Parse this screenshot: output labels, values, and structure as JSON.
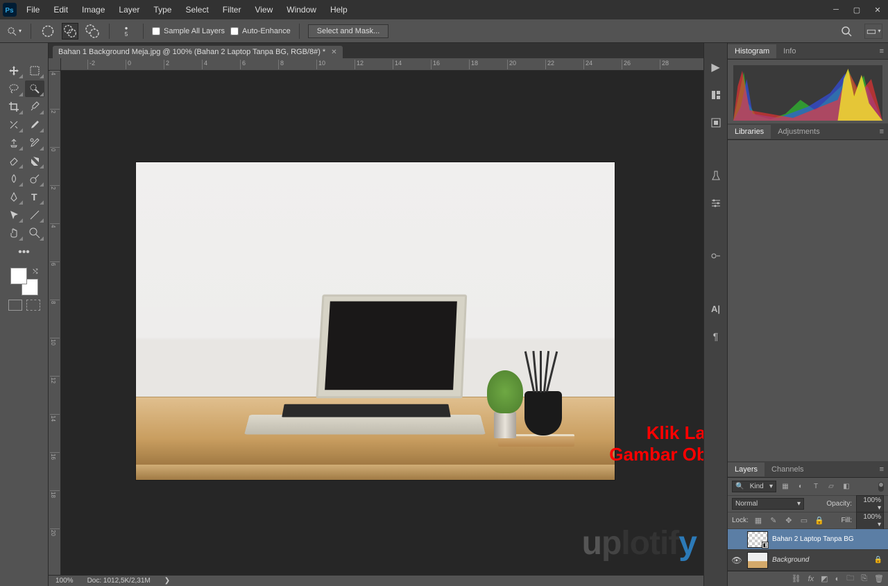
{
  "menubar": [
    "File",
    "Edit",
    "Image",
    "Layer",
    "Type",
    "Select",
    "Filter",
    "View",
    "Window",
    "Help"
  ],
  "options": {
    "brush_size": "5",
    "sample_all": "Sample All Layers",
    "auto_enhance": "Auto-Enhance",
    "select_mask": "Select and Mask..."
  },
  "doc_tab": "Bahan 1 Background Meja.jpg @ 100% (Bahan 2 Laptop Tanpa BG, RGB/8#) *",
  "ruler_h": [
    "-2",
    "0",
    "2",
    "4",
    "6",
    "8",
    "10",
    "12",
    "14",
    "16",
    "18",
    "20",
    "22",
    "24",
    "26",
    "28"
  ],
  "ruler_v": [
    "4",
    "2",
    "0",
    "2",
    "4",
    "6",
    "8",
    "10",
    "12",
    "14",
    "16",
    "18",
    "20"
  ],
  "annotation_line1": "Klik Layer",
  "annotation_line2": "Gambar Objek",
  "watermark": {
    "u": "u",
    "p": "p",
    "lotif": "lotif",
    "y": "y"
  },
  "status": {
    "zoom": "100%",
    "doc": "Doc: 1012,5K/2,31M",
    "caret": "❯"
  },
  "panels": {
    "histogram_tab": "Histogram",
    "info_tab": "Info",
    "libraries_tab": "Libraries",
    "adjustments_tab": "Adjustments",
    "layers_tab": "Layers",
    "channels_tab": "Channels"
  },
  "layers": {
    "kind_label": "Kind",
    "blend_mode": "Normal",
    "opacity_label": "Opacity:",
    "opacity_value": "100%",
    "lock_label": "Lock:",
    "fill_label": "Fill:",
    "fill_value": "100%",
    "rows": [
      {
        "name": "Bahan 2 Laptop Tanpa BG",
        "italic": false,
        "selected": true,
        "eye": false,
        "checker": true,
        "smart": true,
        "locked": false
      },
      {
        "name": "Background",
        "italic": true,
        "selected": false,
        "eye": true,
        "checker": false,
        "smart": false,
        "locked": true
      }
    ]
  }
}
